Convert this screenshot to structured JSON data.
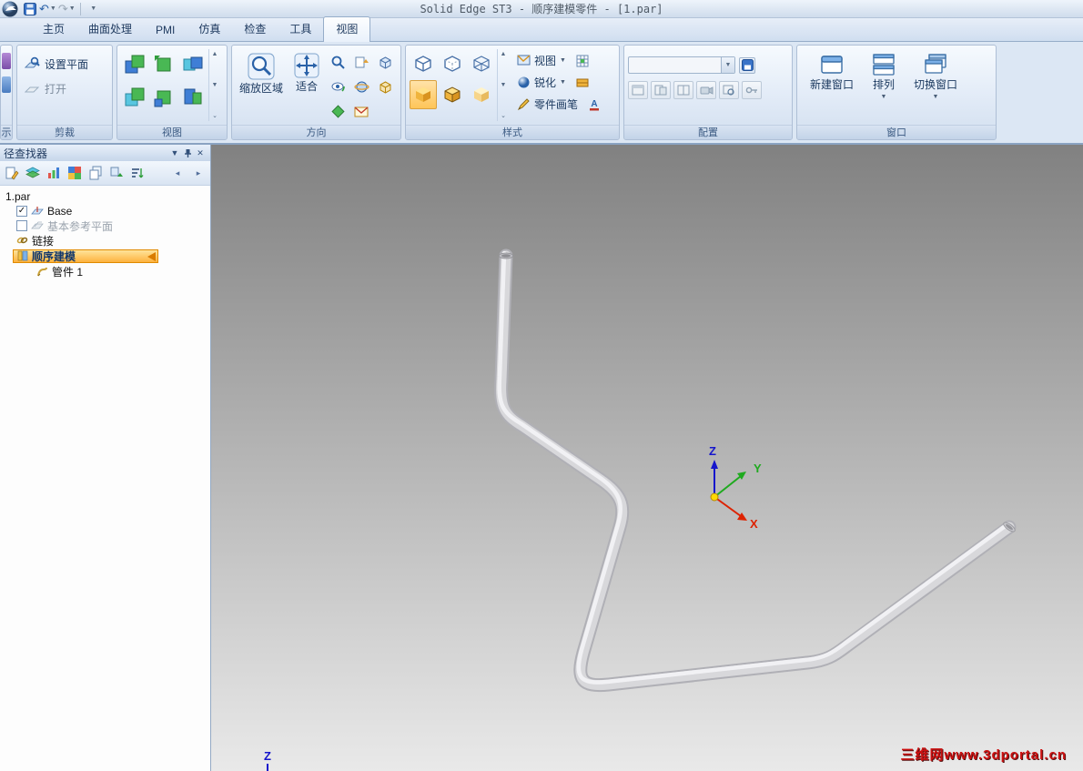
{
  "window": {
    "title": "Solid Edge ST3 - 顺序建模零件 - [1.par]"
  },
  "tabs": [
    "主页",
    "曲面处理",
    "PMI",
    "仿真",
    "检查",
    "工具",
    "视图"
  ],
  "ribbon": {
    "partial_group_label": "示",
    "clipping": {
      "label": "剪裁",
      "set_plane": "设置平面",
      "open": "打开"
    },
    "views": {
      "label": "视图"
    },
    "orientation": {
      "label": "方向",
      "zoom_area": "缩放区域",
      "fit": "适合"
    },
    "style": {
      "label": "样式",
      "view": "视图",
      "sharpen": "锐化",
      "part_painter": "零件画笔"
    },
    "configurations": {
      "label": "配置"
    },
    "window_group": {
      "label": "窗口",
      "new_window": "新建窗口",
      "arrange": "排列",
      "switch_windows": "切换窗口"
    }
  },
  "pathfinder": {
    "title": "径查找器",
    "tree": [
      {
        "label": "1.par"
      },
      {
        "label": "Base",
        "checked": "✓"
      },
      {
        "label": "基本参考平面"
      },
      {
        "label": "链接"
      },
      {
        "label": "顺序建模"
      },
      {
        "label": "管件 1"
      }
    ]
  },
  "viewport": {
    "triad": {
      "x": "X",
      "y": "Y",
      "z": "Z"
    },
    "corner_axis": "Z",
    "watermark": "三维网www.3dportal.cn"
  },
  "colors": {
    "axis_x": "#dd2200",
    "axis_y": "#1faa1f",
    "axis_z": "#1515cc",
    "highlight_orange": "#fdb23e",
    "watermark_red": "#cc1111"
  }
}
